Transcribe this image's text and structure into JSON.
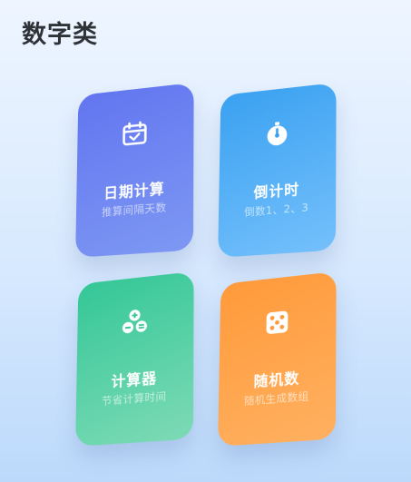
{
  "section": {
    "title": "数字类"
  },
  "cards": [
    {
      "title": "日期计算",
      "subtitle": "推算间隔天数",
      "icon": "calendar-icon",
      "color": "#6a80f1"
    },
    {
      "title": "倒计时",
      "subtitle": "倒数1、2、3",
      "icon": "stopwatch-icon",
      "color": "#4aaaf4"
    },
    {
      "title": "计算器",
      "subtitle": "节省计算时间",
      "icon": "calculator-icon",
      "color": "#4fcfa2"
    },
    {
      "title": "随机数",
      "subtitle": "随机生成数组",
      "icon": "dice-icon",
      "color": "#ffa245"
    }
  ]
}
